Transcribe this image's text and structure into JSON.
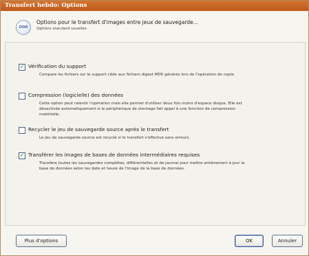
{
  "window": {
    "title": "Transfert hebdo: Options"
  },
  "header": {
    "icon": "options-globe-icon",
    "icon_text": "OOO",
    "title": "Options pour le transfert d'images entre jeux de sauvegarde...",
    "subtitle": "Options standard usuelles"
  },
  "options": [
    {
      "label": "Vérification du support",
      "checked": true,
      "description": "Compare les fichiers sur le support cible aux fichiers digest MD5 générés lors de l'opération de copie."
    },
    {
      "label": "Compression (logicielle) des données",
      "checked": false,
      "description": "Cette option peut ralentir l'opération mais elle permet d'utiliser deux fois moins d'espace disque. Elle est désactivée automatiquement si le périphérique de stockage fait appel à une fonction de compression matérielle."
    },
    {
      "label": "Recycler le jeu de sauvegarde source après le transfert",
      "checked": false,
      "description": "Le jeu de sauvegarde source est recyclé si le transfert s'effectue sans erreurs."
    },
    {
      "label": "Transférer les images de bases de données intermédiaires requises",
      "checked": true,
      "description": "Transfère toutes les sauvegardes complètes, différentielles et de journal pour mettre entièrement à jour la base de données selon les date et heure de l'image de la base de données."
    }
  ],
  "buttons": {
    "more_options": "Plus d'options",
    "ok": "OK",
    "cancel": "Annuler"
  },
  "colors": {
    "titlebar": "#c9651f",
    "check": "#21a121",
    "checkbox_border": "#4d6185"
  }
}
